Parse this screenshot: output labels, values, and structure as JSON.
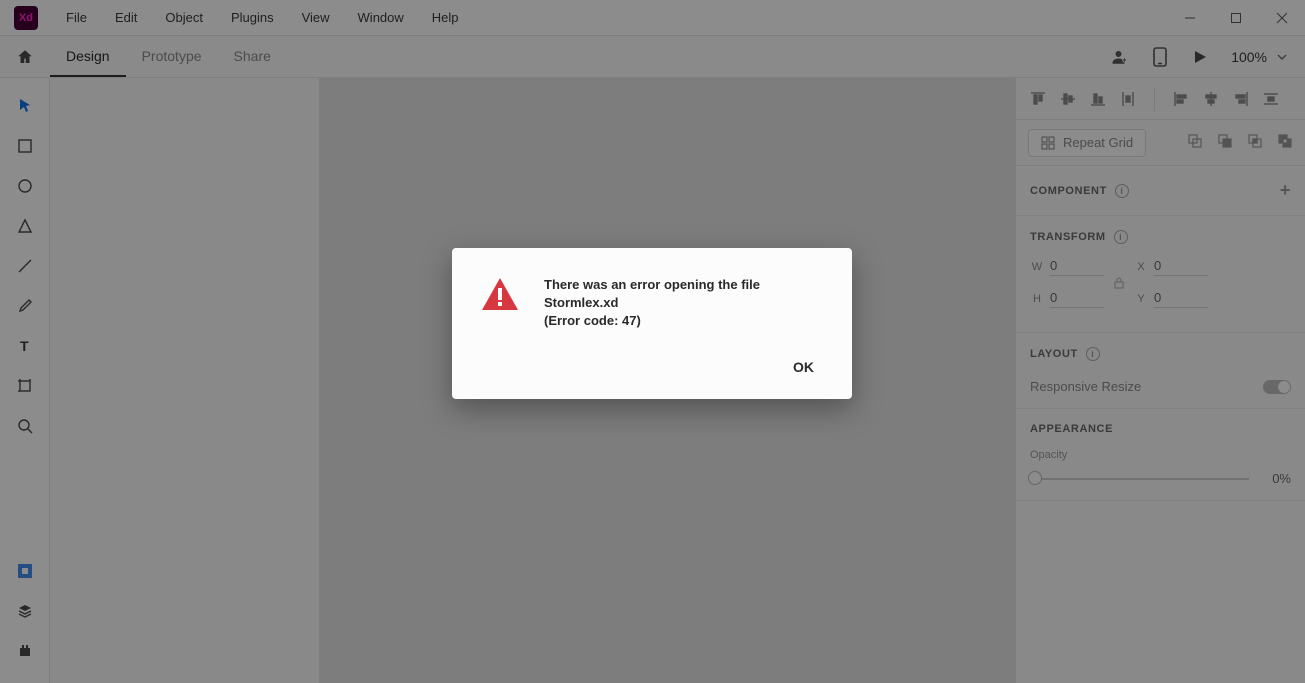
{
  "menubar": {
    "items": [
      "File",
      "Edit",
      "Object",
      "Plugins",
      "View",
      "Window",
      "Help"
    ]
  },
  "app": {
    "logo": "Xd"
  },
  "modes": {
    "design": "Design",
    "prototype": "Prototype",
    "share": "Share"
  },
  "zoom": {
    "value": "100%"
  },
  "right_panel": {
    "repeat_grid": "Repeat Grid",
    "component_title": "COMPONENT",
    "transform_title": "TRANSFORM",
    "w_label": "W",
    "w_val": "0",
    "x_label": "X",
    "x_val": "0",
    "h_label": "H",
    "h_val": "0",
    "y_label": "Y",
    "y_val": "0",
    "layout_title": "LAYOUT",
    "responsive_resize": "Responsive Resize",
    "appearance_title": "APPEARANCE",
    "opacity_label": "Opacity",
    "opacity_value": "0%"
  },
  "dialog": {
    "line1": "There was an error opening the file Stormlex.xd",
    "line2": "(Error code: 47)",
    "ok": "OK"
  }
}
